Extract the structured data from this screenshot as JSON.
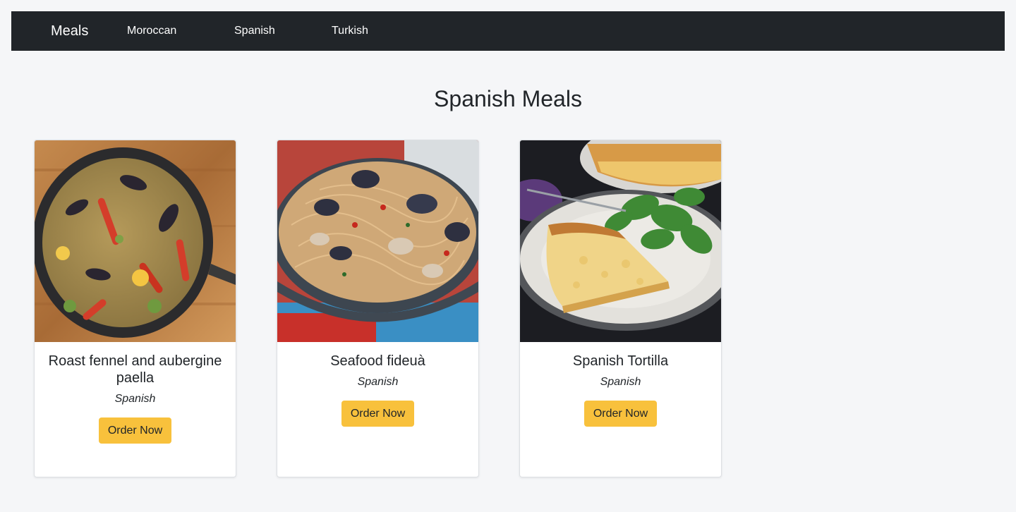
{
  "nav": {
    "brand": "Meals",
    "links": [
      "Moroccan",
      "Spanish",
      "Turkish"
    ]
  },
  "page": {
    "title": "Spanish Meals"
  },
  "meals": [
    {
      "name": "Roast fennel and aubergine paella",
      "cuisine": "Spanish",
      "button": "Order Now",
      "image": "paella-photo"
    },
    {
      "name": "Seafood fideuà",
      "cuisine": "Spanish",
      "button": "Order Now",
      "image": "seafood-pasta-photo"
    },
    {
      "name": "Spanish Tortilla",
      "cuisine": "Spanish",
      "button": "Order Now",
      "image": "tortilla-photo"
    }
  ],
  "colors": {
    "navbar": "#212529",
    "background": "#f5f6f8",
    "button": "#f8c13c"
  }
}
